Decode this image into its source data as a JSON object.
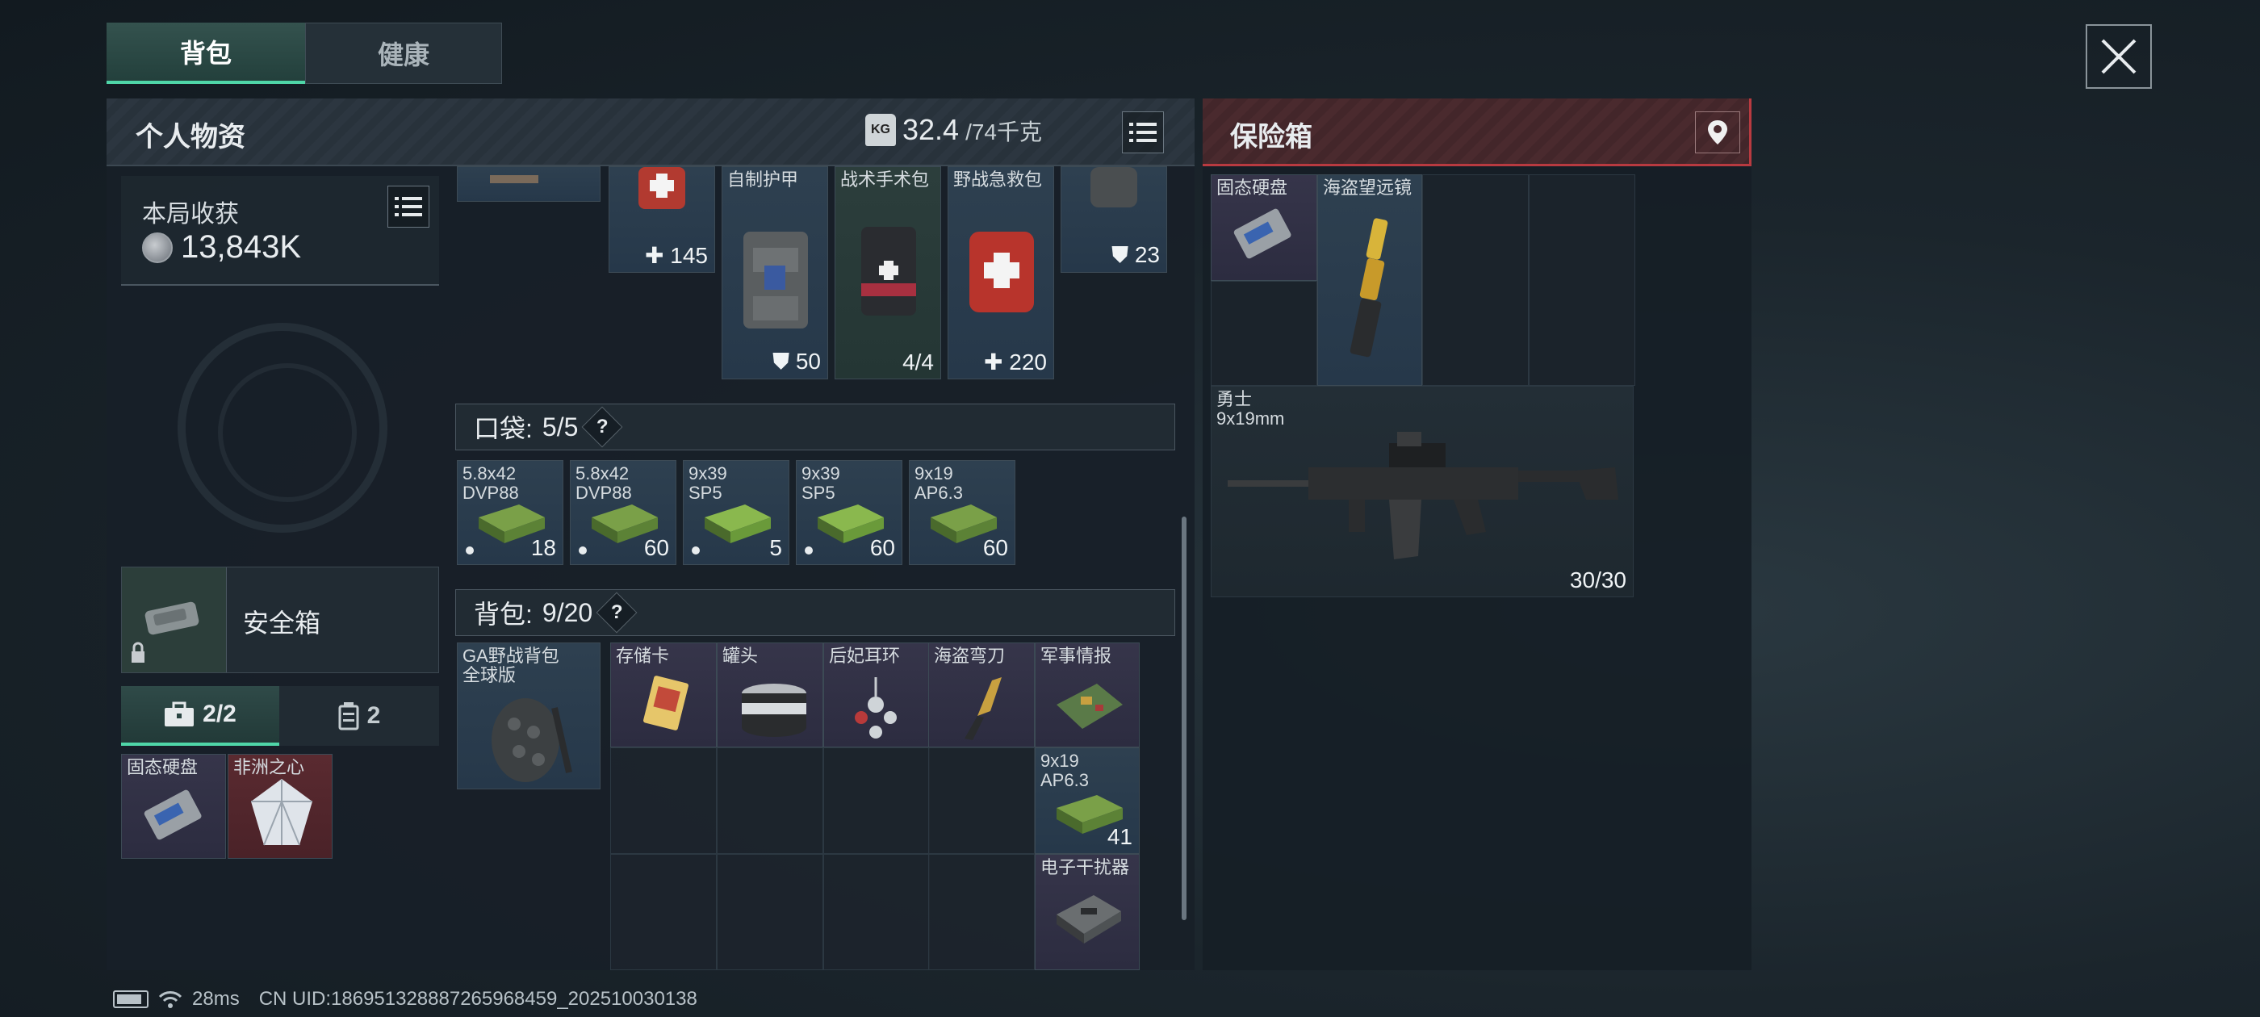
{
  "tabs": {
    "backpack": "背包",
    "health": "健康"
  },
  "personal": {
    "title": "个人物资",
    "weight_current": "32.4",
    "weight_max": "/74千克",
    "kg_badge": "KG"
  },
  "harvest": {
    "label": "本局收获",
    "value": "13,843K"
  },
  "safebox": {
    "label": "安全箱"
  },
  "subtabs": {
    "tools": "2/2",
    "cases": "2"
  },
  "safe_slots": [
    {
      "name": "固态硬盘"
    },
    {
      "name": "非洲之心"
    }
  ],
  "gear_top": [
    {
      "name": "",
      "count": "145"
    },
    {
      "name": "自制护甲",
      "count": "50"
    },
    {
      "name": "战术手术包",
      "count": "4/4"
    },
    {
      "name": "野战急救包",
      "count": "220"
    },
    {
      "name": "",
      "count": "23"
    }
  ],
  "pocket": {
    "label": "口袋:",
    "value": "5/5",
    "help": "?"
  },
  "pocket_items": [
    {
      "name": "5.8x42\nDVP88",
      "count": "18"
    },
    {
      "name": "5.8x42\nDVP88",
      "count": "60"
    },
    {
      "name": "9x39\nSP5",
      "count": "5"
    },
    {
      "name": "9x39\nSP5",
      "count": "60"
    },
    {
      "name": "9x19\nAP6.3",
      "count": "60"
    }
  ],
  "bag": {
    "label": "背包:",
    "value": "9/20",
    "help": "?"
  },
  "bag_main": {
    "name": "GA野战背包\n全球版"
  },
  "bag_items": [
    {
      "name": "存储卡"
    },
    {
      "name": "罐头"
    },
    {
      "name": "后妃耳环"
    },
    {
      "name": "海盗弯刀"
    },
    {
      "name": "军事情报"
    },
    {
      "name": "9x19\nAP6.3",
      "count": "41"
    },
    {
      "name": "电子干扰器"
    }
  ],
  "safe_box": {
    "title": "保险箱",
    "items": [
      {
        "name": "固态硬盘"
      },
      {
        "name": "海盗望远镜"
      },
      {
        "name": "勇士\n9x19mm",
        "count": "30/30"
      }
    ]
  },
  "status": {
    "ping": "28ms",
    "uid": "CN UID:186951328887265968459_202510030138"
  }
}
